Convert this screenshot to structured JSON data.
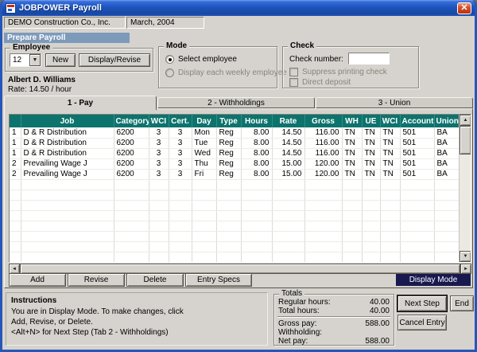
{
  "window": {
    "title": "JOBPOWER Payroll",
    "close_glyph": "✕"
  },
  "infobar": {
    "company": "DEMO Construction Co., Inc.",
    "period": "March, 2004"
  },
  "section": {
    "title": "Prepare Payroll"
  },
  "employee": {
    "legend": "Employee",
    "number": "12",
    "dropdown_glyph": "▼",
    "new_button": "New",
    "display_revise_button": "Display/Revise",
    "name": "Albert D. Williams",
    "rate": "Rate:  14.50 / hour"
  },
  "mode": {
    "legend": "Mode",
    "select_employee": "Select employee",
    "display_each": "Display each weekly employee"
  },
  "check": {
    "legend": "Check",
    "number_label": "Check number:",
    "number_value": "",
    "suppress": "Suppress printing check",
    "direct_deposit": "Direct deposit"
  },
  "tabs": [
    {
      "label": "1 - Pay"
    },
    {
      "label": "2 - Withholdings"
    },
    {
      "label": "3 - Union"
    }
  ],
  "grid": {
    "columns": [
      "",
      "Job",
      "Category",
      "WCI",
      "Cert.",
      "Day",
      "Type",
      "Hours",
      "Rate",
      "Gross",
      "WH",
      "UE",
      "WCI",
      "Account",
      "Union"
    ],
    "rows": [
      [
        "1",
        "D & R Distribution",
        "6200",
        "3",
        "3",
        "Mon",
        "Reg",
        "8.00",
        "14.50",
        "116.00",
        "TN",
        "TN",
        "TN",
        "501",
        "BA"
      ],
      [
        "1",
        "D & R Distribution",
        "6200",
        "3",
        "3",
        "Tue",
        "Reg",
        "8.00",
        "14.50",
        "116.00",
        "TN",
        "TN",
        "TN",
        "501",
        "BA"
      ],
      [
        "1",
        "D & R Distribution",
        "6200",
        "3",
        "3",
        "Wed",
        "Reg",
        "8.00",
        "14.50",
        "116.00",
        "TN",
        "TN",
        "TN",
        "501",
        "BA"
      ],
      [
        "2",
        "Prevailing Wage J",
        "6200",
        "3",
        "3",
        "Thu",
        "Reg",
        "8.00",
        "15.00",
        "120.00",
        "TN",
        "TN",
        "TN",
        "501",
        "BA"
      ],
      [
        "2",
        "Prevailing Wage J",
        "6200",
        "3",
        "3",
        "Fri",
        "Reg",
        "8.00",
        "15.00",
        "120.00",
        "TN",
        "TN",
        "TN",
        "501",
        "BA"
      ]
    ],
    "scroll_up_glyph": "▲",
    "scroll_down_glyph": "▼",
    "scroll_left_glyph": "◄",
    "scroll_right_glyph": "►"
  },
  "grid_actions": {
    "add": "Add",
    "revise": "Revise",
    "delete": "Delete",
    "entry_specs": "Entry Specs",
    "mode_indicator": "Display Mode"
  },
  "instructions": {
    "title": "Instructions",
    "line1": "You are in Display Mode.  To make changes, click",
    "line2": "Add, Revise, or Delete.",
    "line3": "<Alt+N> for Next Step (Tab 2 - Withholdings)"
  },
  "totals": {
    "legend": "Totals",
    "rows": [
      {
        "label": "Regular hours:",
        "value": "40.00"
      },
      {
        "label": "Total hours:",
        "value": "40.00"
      },
      {
        "label": "Gross pay:",
        "value": "588.00"
      },
      {
        "label": "Withholding:",
        "value": ""
      },
      {
        "label": "Net pay:",
        "value": "588.00"
      }
    ]
  },
  "actions": {
    "next_step": "Next Step",
    "end": "End",
    "cancel_entry": "Cancel Entry"
  },
  "colors": {
    "grid_header_bg": "#0d736d",
    "section_bar_bg": "#7e9aba",
    "mode_indicator_bg": "#191950",
    "titlebar_blue": "#1d54bd"
  }
}
